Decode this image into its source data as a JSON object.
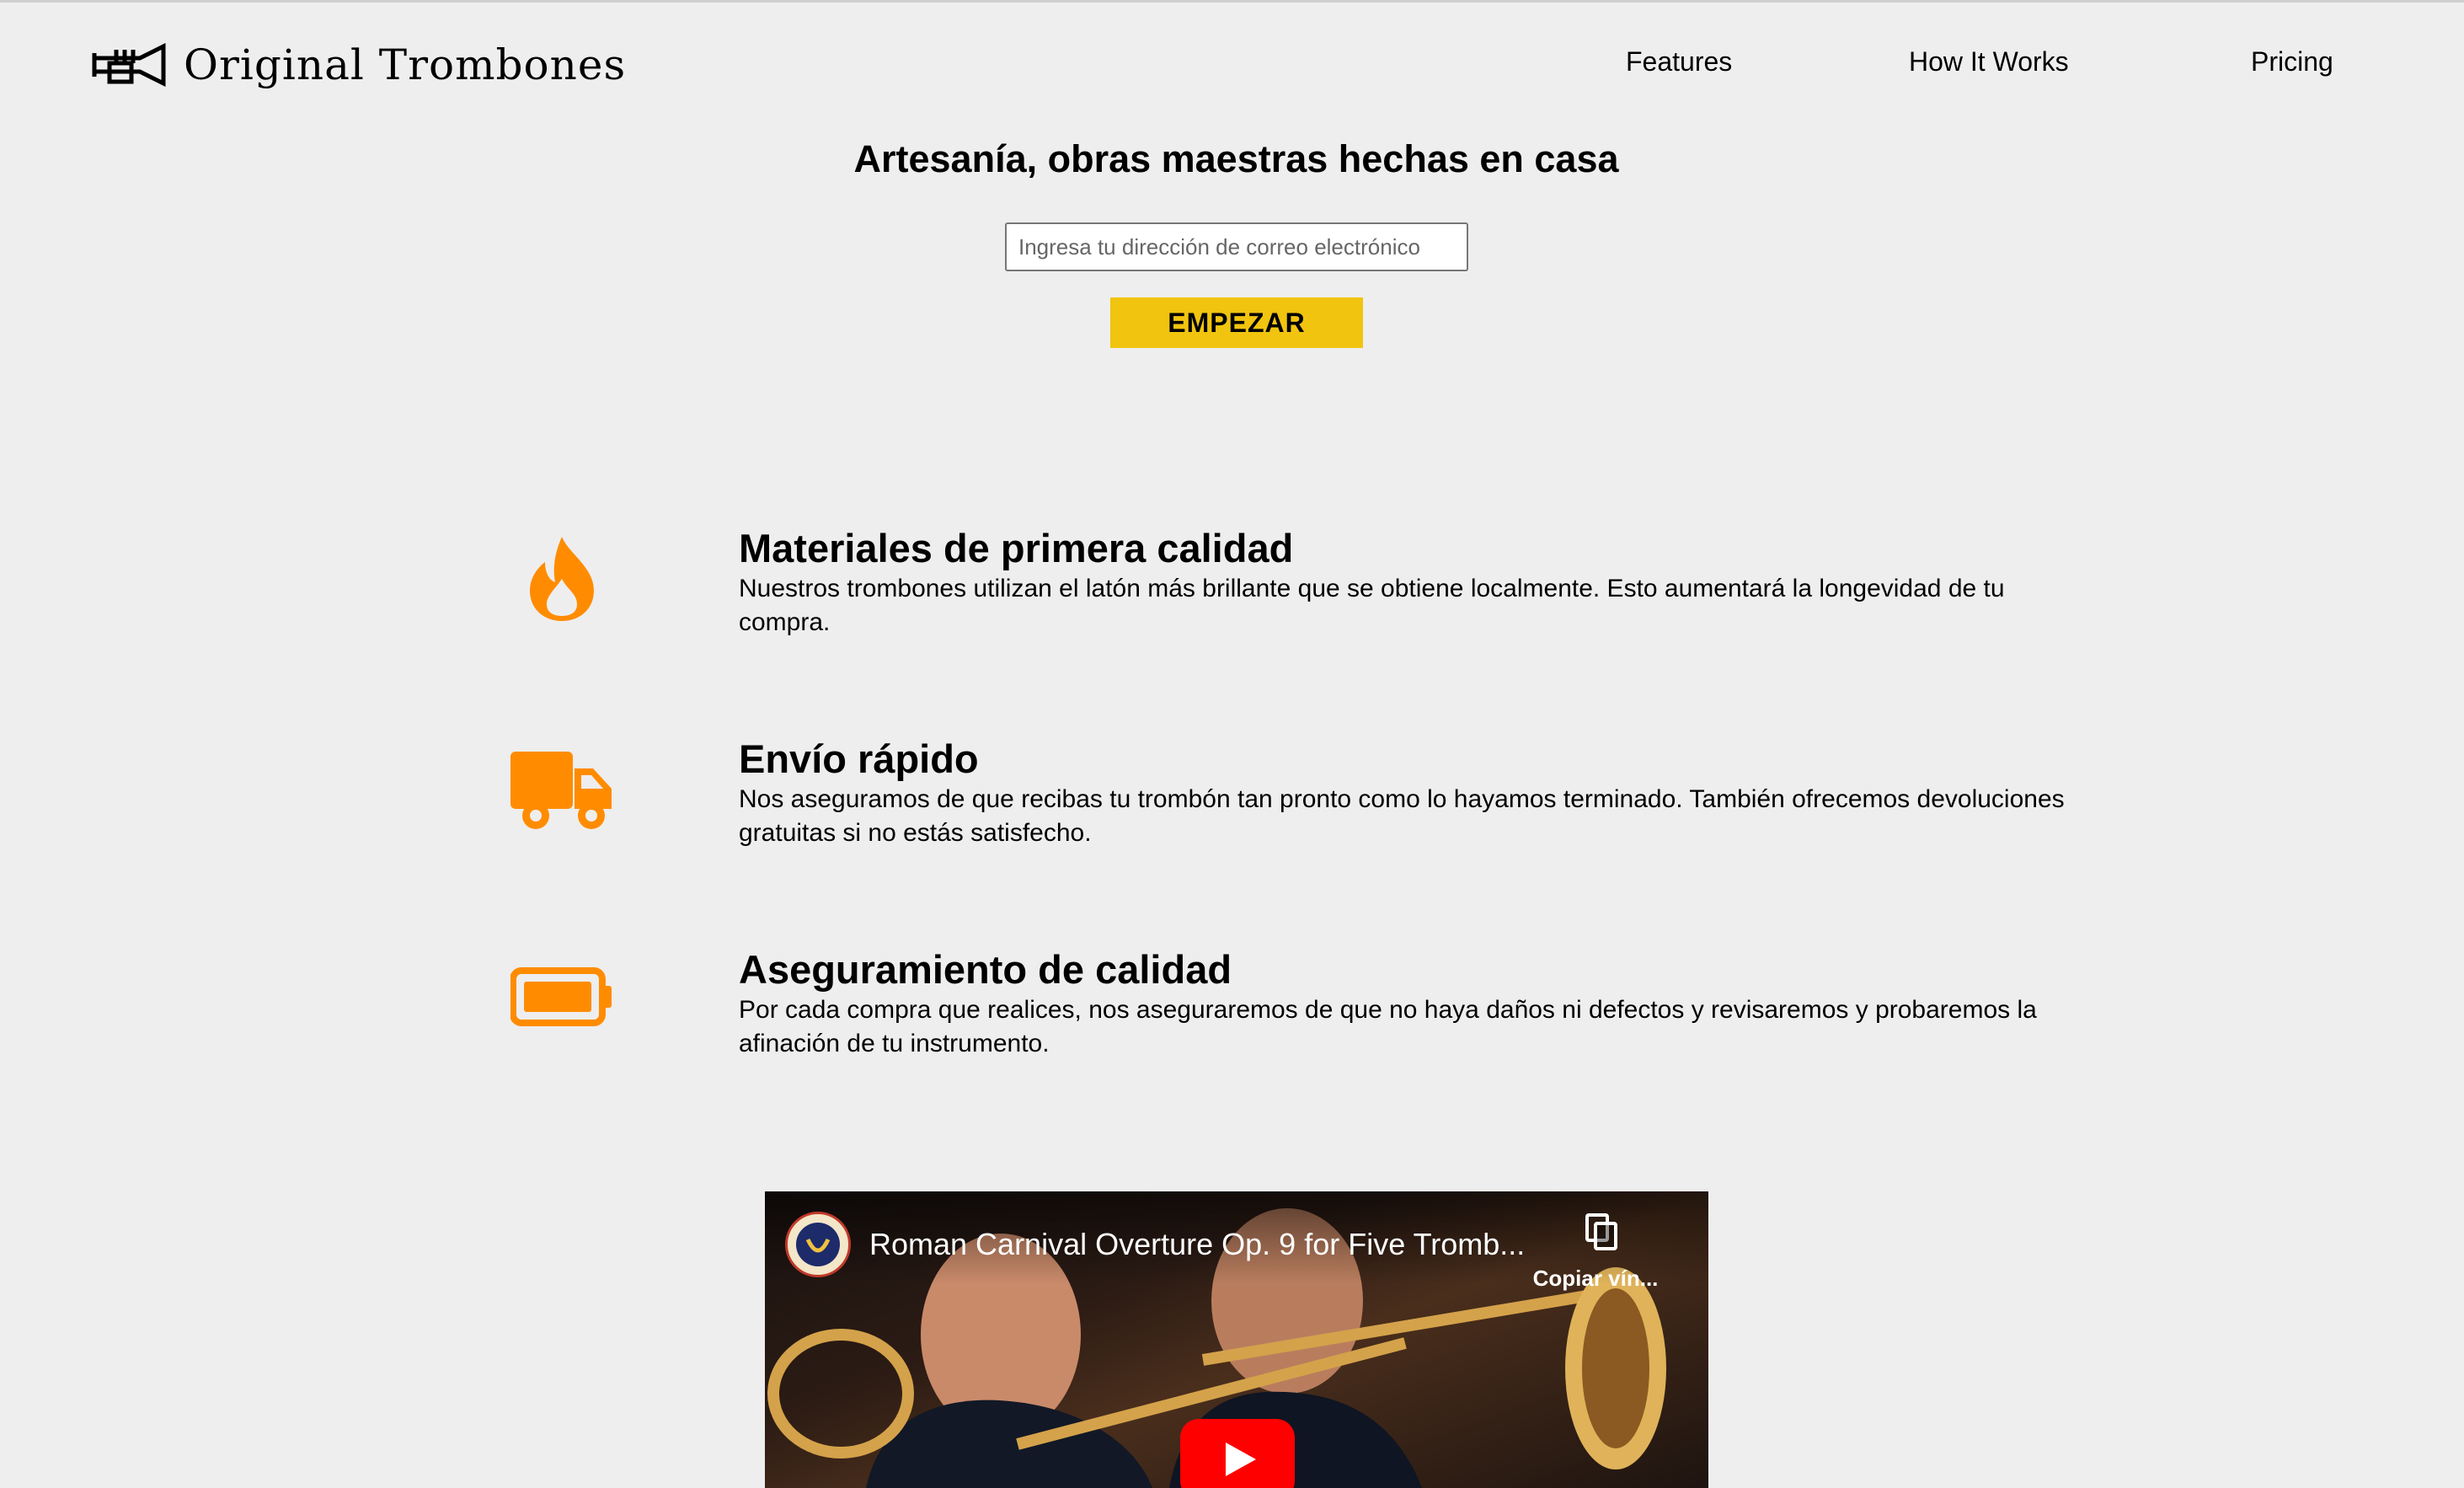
{
  "header": {
    "logo_text": "Original Trombones",
    "nav": [
      {
        "label": "Features"
      },
      {
        "label": "How It Works"
      },
      {
        "label": "Pricing"
      }
    ]
  },
  "hero": {
    "title": "Artesanía, obras maestras hechas en casa",
    "email_placeholder": "Ingresa tu dirección de correo electrónico",
    "button_label": "EMPEZAR",
    "button_color": "#f1c40f"
  },
  "features": [
    {
      "icon": "fire-icon",
      "title": "Materiales de primera calidad",
      "description": "Nuestros trombones utilizan el latón más brillante que se obtiene localmente. Esto aumentará la longevidad de tu compra."
    },
    {
      "icon": "truck-icon",
      "title": "Envío rápido",
      "description": "Nos aseguramos de que recibas tu trombón tan pronto como lo hayamos terminado. También ofrecemos devoluciones gratuitas si no estás satisfecho."
    },
    {
      "icon": "battery-icon",
      "title": "Aseguramiento de calidad",
      "description": "Por cada compra que realices, nos aseguraremos de que no haya daños ni defectos y revisaremos y probaremos la afinación de tu instrumento."
    }
  ],
  "icon_color": "#ff8c00",
  "video": {
    "title": "Roman Carnival Overture Op. 9 for Five Tromb...",
    "copy_label": "Copiar vín..."
  }
}
